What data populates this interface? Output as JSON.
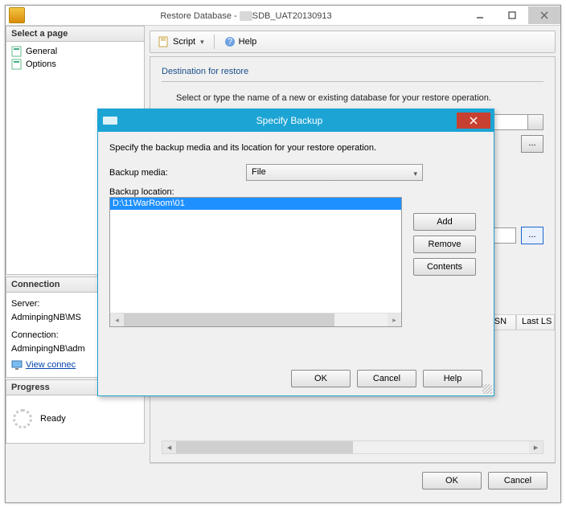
{
  "window": {
    "title_prefix": "Restore Database - ",
    "title_obscured": "        ",
    "title_suffix": "SDB_UAT20130913"
  },
  "left": {
    "select_page_header": "Select a page",
    "pages": [
      "General",
      "Options"
    ],
    "connection_header": "Connection",
    "server_label": "Server:",
    "server_value": "AdminpingNB\\MS",
    "connection_label": "Connection:",
    "connection_value": "AdminpingNB\\adm",
    "view_conn": "View connec",
    "progress_header": "Progress",
    "progress_status": "Ready"
  },
  "toolbar": {
    "script": "Script",
    "help": "Help"
  },
  "content": {
    "dest_header": "Destination for restore",
    "dest_instr": "Select or type the name of a new or existing database for your restore operation.",
    "grid_cols": [
      "st LSN",
      "Last LS"
    ]
  },
  "modal": {
    "title": "Specify Backup",
    "instr": "Specify the backup media and its location for your restore operation.",
    "media_label": "Backup media:",
    "media_value": "File",
    "location_label": "Backup location:",
    "selected_path": "D:\\11WarRoom\\01",
    "btn_add": "Add",
    "btn_remove": "Remove",
    "btn_contents": "Contents",
    "btn_ok": "OK",
    "btn_cancel": "Cancel",
    "btn_help": "Help"
  },
  "buttons": {
    "ok": "OK",
    "cancel": "Cancel"
  }
}
